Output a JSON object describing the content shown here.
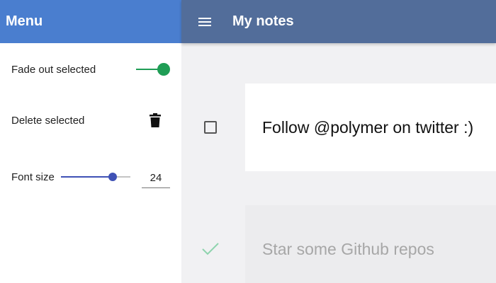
{
  "drawer": {
    "title": "Menu",
    "fade_out": {
      "label": "Fade out selected",
      "enabled": true
    },
    "delete_selected": {
      "label": "Delete selected",
      "icon": "trash-icon"
    },
    "font_size": {
      "label": "Font size",
      "value": "24",
      "slider_fraction": 0.74
    }
  },
  "toolbar": {
    "menu_icon": "hamburger-menu-icon",
    "title": "My notes"
  },
  "notes": [
    {
      "text": "Follow @polymer on twitter :)",
      "done": false
    },
    {
      "text": "Star some Github repos",
      "done": true
    }
  ],
  "colors": {
    "drawer_header": "#4a7ecf",
    "toolbar": "#526d9a",
    "toggle_on": "#1f9d55",
    "slider": "#3f51b5",
    "check_done": "#8fd4ae"
  }
}
